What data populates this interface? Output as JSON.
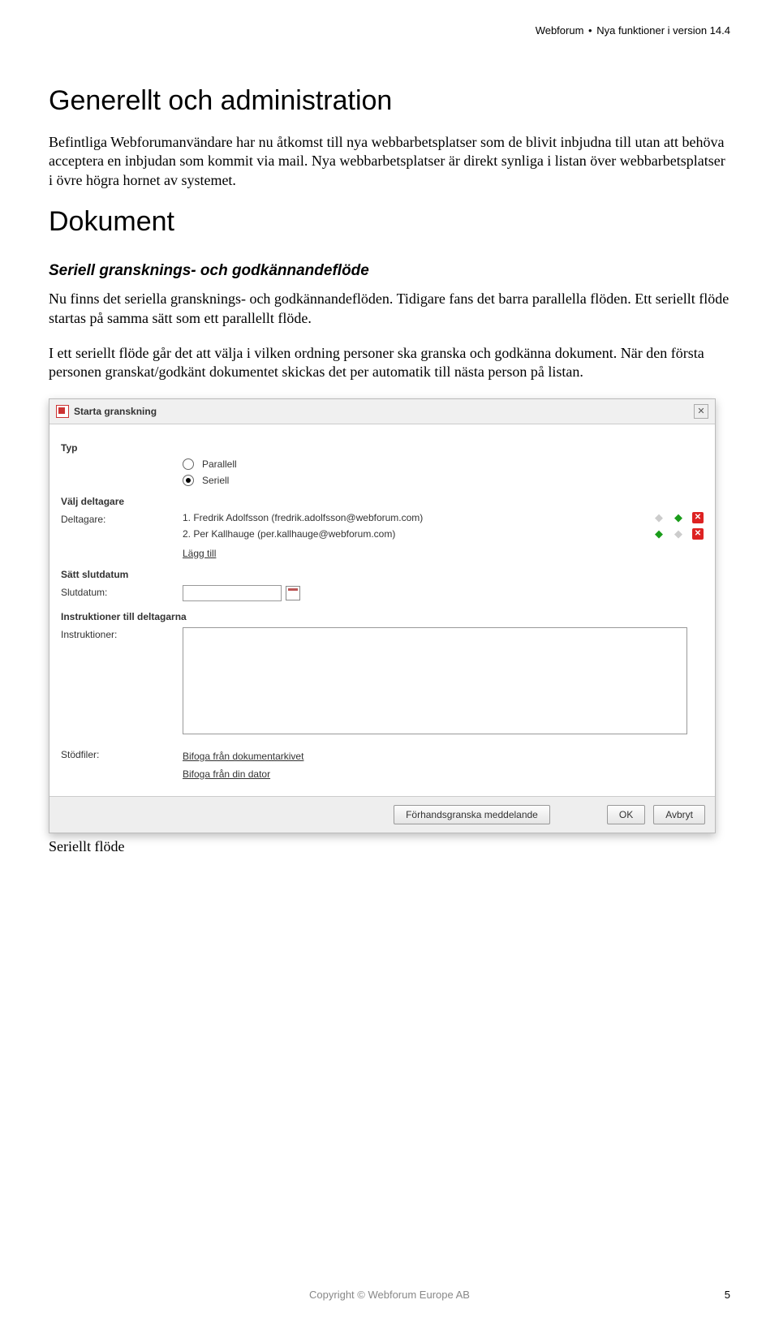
{
  "header": {
    "left": "Webforum",
    "right": "Nya  funktioner i version 14.4"
  },
  "h1a": "Generellt och administration",
  "p1": "Befintliga Webforumanvändare har nu åtkomst till nya webbarbetsplatser som de blivit inbjudna till utan att behöva acceptera en inbjudan som kommit via mail. Nya webbarbetsplatser är direkt synliga i listan över webbarbetsplatser i övre högra hornet av systemet.",
  "h1b": "Dokument",
  "h2": "Seriell gransknings- och godkännandeflöde",
  "p2": "Nu finns det seriella gransknings- och godkännandeflöden. Tidigare fans det barra parallella flöden. Ett seriellt flöde startas på samma sätt som ett parallellt flöde.",
  "p3": "I ett seriellt flöde går det att välja i vilken ordning personer ska granska och godkänna dokument. När den första personen granskat/godkänt dokumentet skickas det per automatik till nästa person på listan.",
  "dialog": {
    "title": "Starta granskning",
    "section_type": "Typ",
    "radio_parallel": "Parallell",
    "radio_serial": "Seriell",
    "section_participants": "Välj deltagare",
    "label_participants": "Deltagare:",
    "participants": [
      "1. Fredrik Adolfsson (fredrik.adolfsson@webforum.com)",
      "2. Per Kallhauge (per.kallhauge@webforum.com)"
    ],
    "link_add": "Lägg till",
    "section_enddate": "Sätt slutdatum",
    "label_enddate": "Slutdatum:",
    "section_instructions": "Instruktioner till deltagarna",
    "label_instructions": "Instruktioner:",
    "label_files": "Stödfiler:",
    "file_link1": "Bifoga från dokumentarkivet",
    "file_link2": "Bifoga från din dator",
    "btn_preview": "Förhandsgranska meddelande",
    "btn_ok": "OK",
    "btn_cancel": "Avbryt"
  },
  "caption": "Seriellt flöde",
  "footer": {
    "copyright": "Copyright © Webforum Europe AB",
    "page": "5"
  }
}
